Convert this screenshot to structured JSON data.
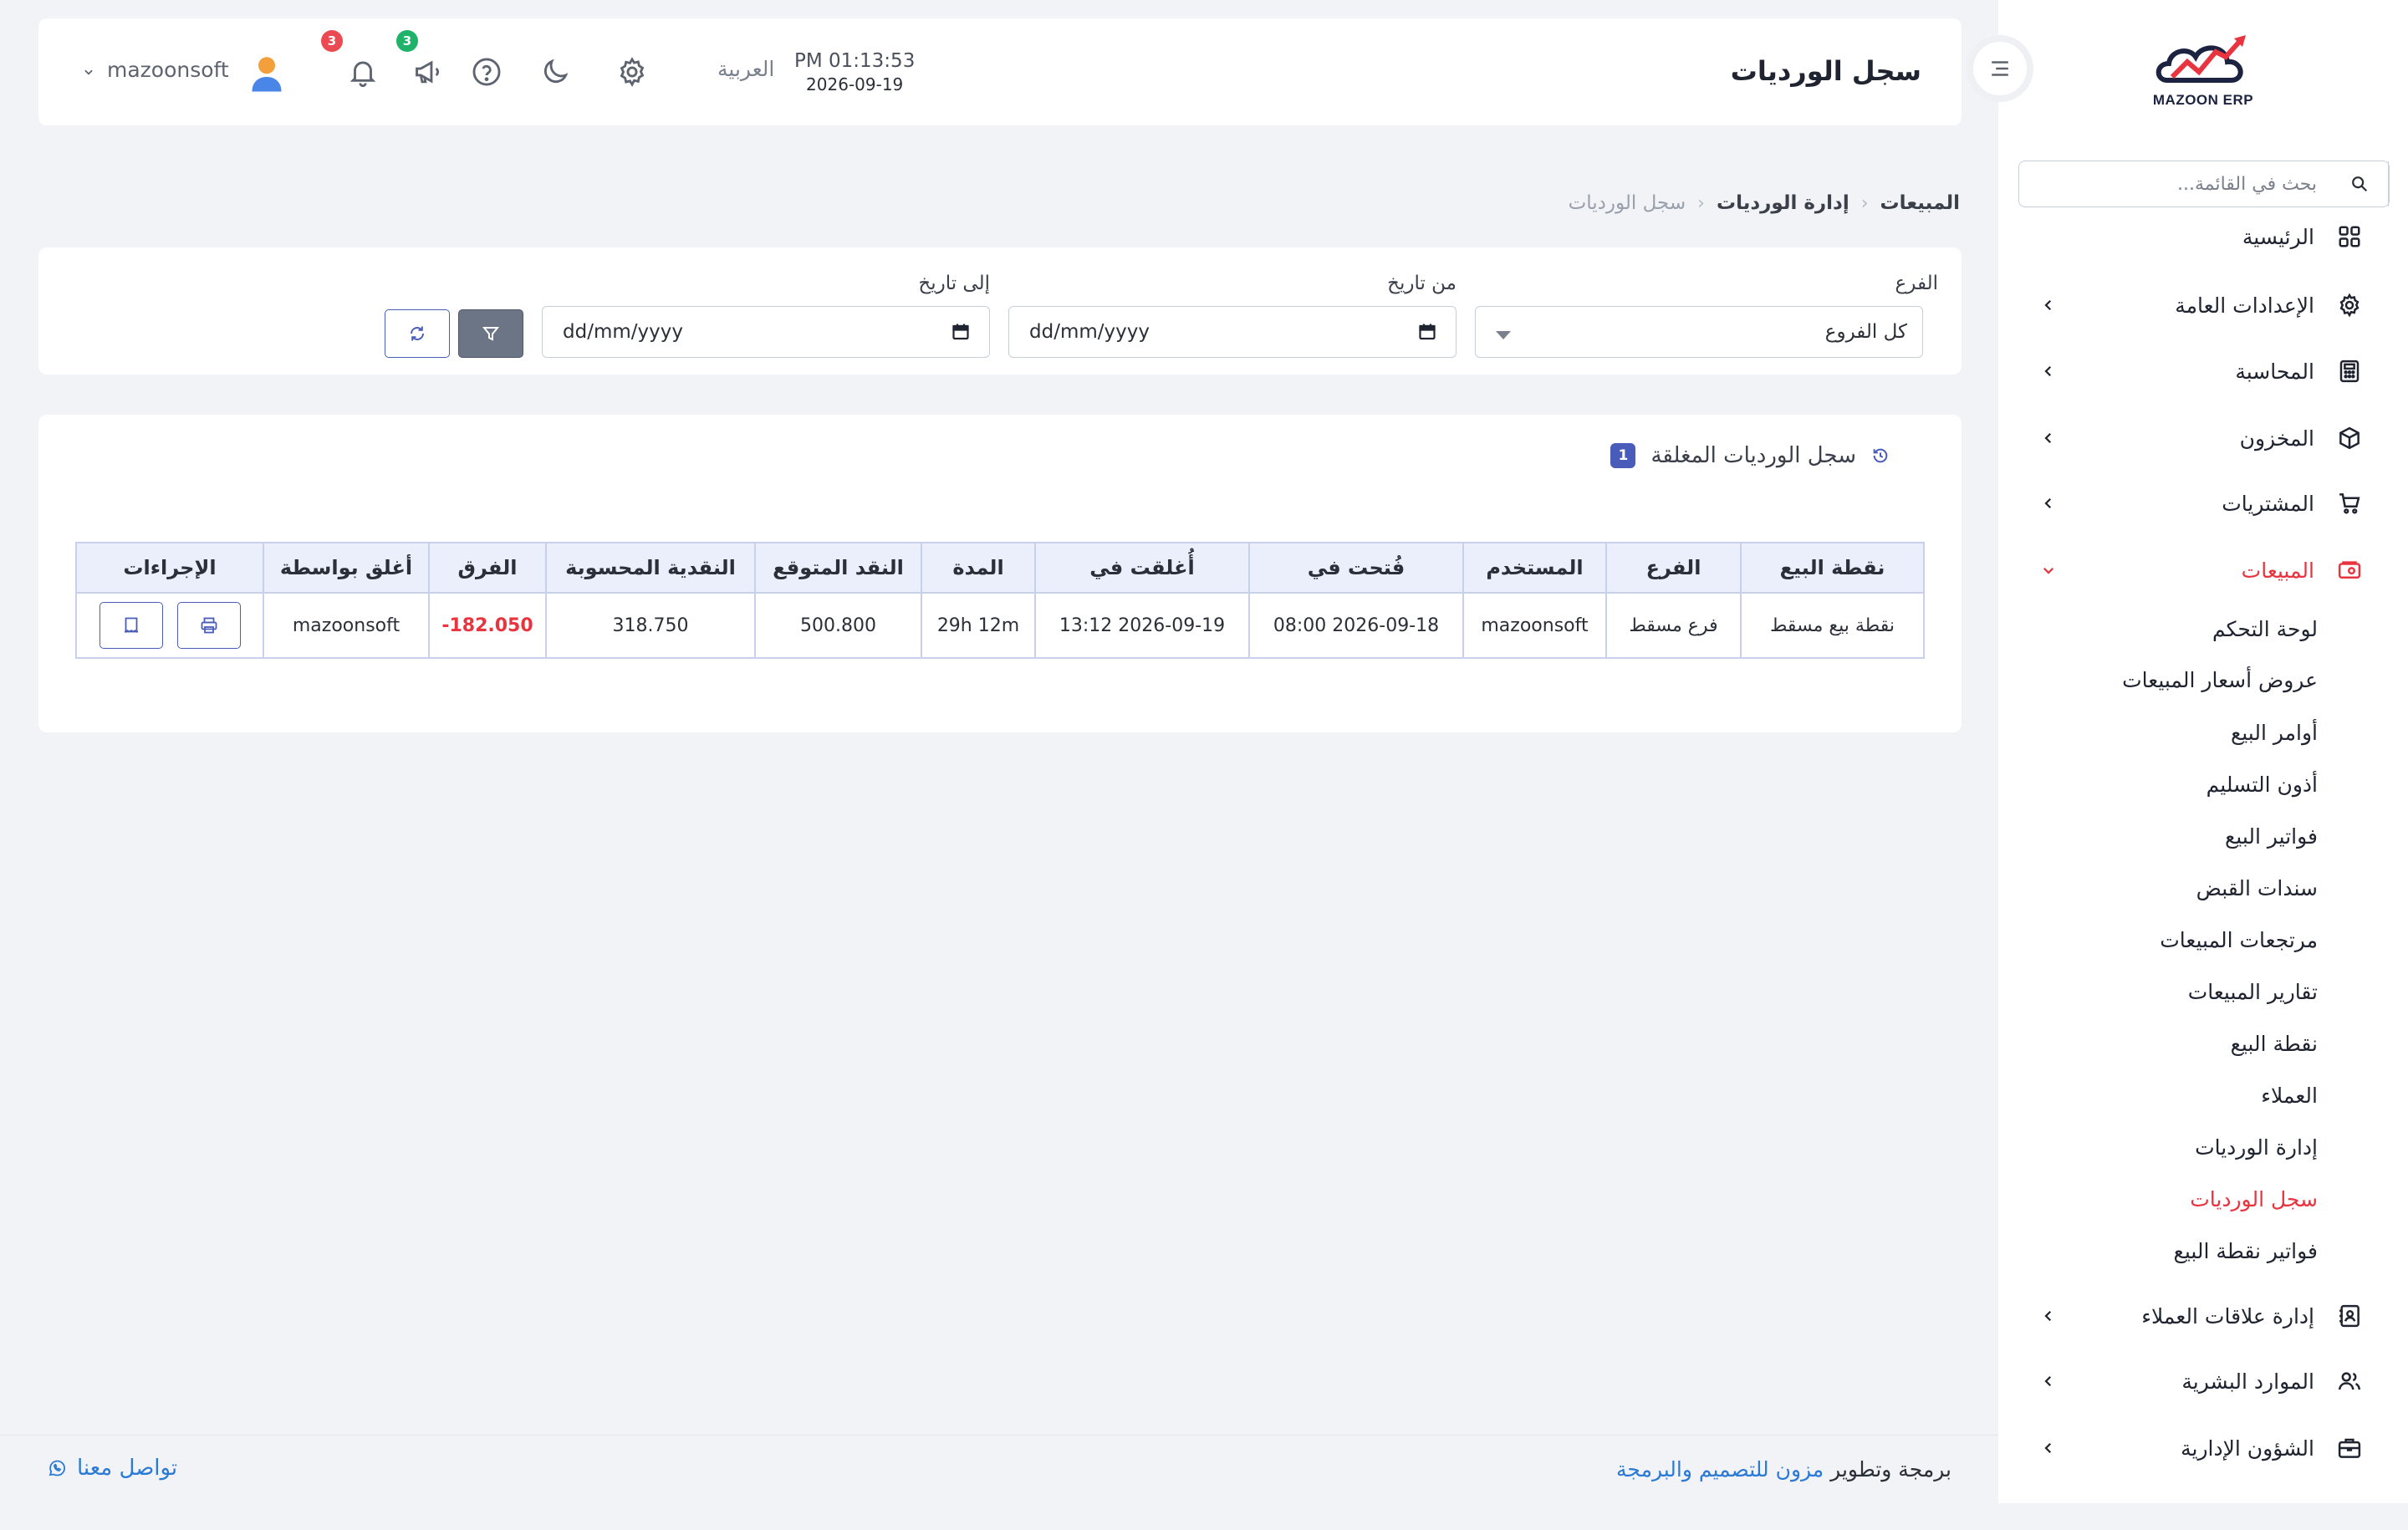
{
  "header": {
    "page_title": "سجل الورديات",
    "clock_time": "PM 01:13:53",
    "clock_date": "2026-09-19",
    "language": "العربية",
    "notifications_count": "3",
    "announcements_count": "3",
    "user_name": "mazoonsoft"
  },
  "sidebar": {
    "logo_text": "MAZOON ERP",
    "search_placeholder": "بحث في القائمة...",
    "items": [
      {
        "label": "الرئيسية",
        "icon": "grid-icon"
      },
      {
        "label": "الإعدادات العامة",
        "icon": "gear-icon"
      },
      {
        "label": "المحاسبة",
        "icon": "calculator-icon"
      },
      {
        "label": "المخزون",
        "icon": "box-icon"
      },
      {
        "label": "المشتريات",
        "icon": "cart-icon"
      },
      {
        "label": "المبيعات",
        "icon": "sales-icon"
      }
    ],
    "sales_sub_items": [
      "لوحة التحكم",
      "عروض أسعار المبيعات",
      "أوامر البيع",
      "أذون التسليم",
      "فواتير البيع",
      "سندات القبض",
      "مرتجعات المبيعات",
      "تقارير المبيعات",
      "نقطة البيع",
      "العملاء",
      "إدارة الورديات",
      "سجل الورديات",
      "فواتير نقطة البيع"
    ],
    "bottom_items": [
      {
        "label": "إدارة علاقات العملاء",
        "icon": "contacts-icon"
      },
      {
        "label": "الموارد البشرية",
        "icon": "users-icon"
      },
      {
        "label": "الشؤون الإدارية",
        "icon": "briefcase-icon"
      }
    ]
  },
  "breadcrumb": [
    "المبيعات",
    "إدارة الورديات",
    "سجل الورديات"
  ],
  "filters": {
    "branch_label": "الفرع",
    "branch_value": "كل الفروع",
    "from_label": "من تاريخ",
    "from_value": "dd/mm/yyyy",
    "to_label": "إلى تاريخ",
    "to_value": "dd/mm/yyyy"
  },
  "table_card": {
    "title": "سجل الورديات المغلقة",
    "count": "1",
    "columns": [
      "نقطة البيع",
      "الفرع",
      "المستخدم",
      "فُتحت في",
      "أُغلقت في",
      "المدة",
      "النقد المتوقع",
      "النقدية المحسوبة",
      "الفرق",
      "أغلق بواسطة",
      "الإجراءات"
    ],
    "rows": [
      {
        "pos": "نقطة بيع مسقط",
        "branch": "فرع مسقط",
        "user": "mazoonsoft",
        "opened_at": "2026-09-18 08:00",
        "closed_at": "2026-09-19 13:12",
        "duration": "29h 12m",
        "expected_cash": "500.800",
        "counted_cash": "318.750",
        "difference": "-182.050",
        "closed_by": "mazoonsoft"
      }
    ]
  },
  "footer": {
    "credit_prefix": "برمجة وتطوير ",
    "credit_company": "مزون للتصميم والبرمجة",
    "contact": "تواصل معنا"
  },
  "colors": {
    "accent": "#4a5cba",
    "danger": "#e8343f",
    "link": "#2b7ad6"
  }
}
